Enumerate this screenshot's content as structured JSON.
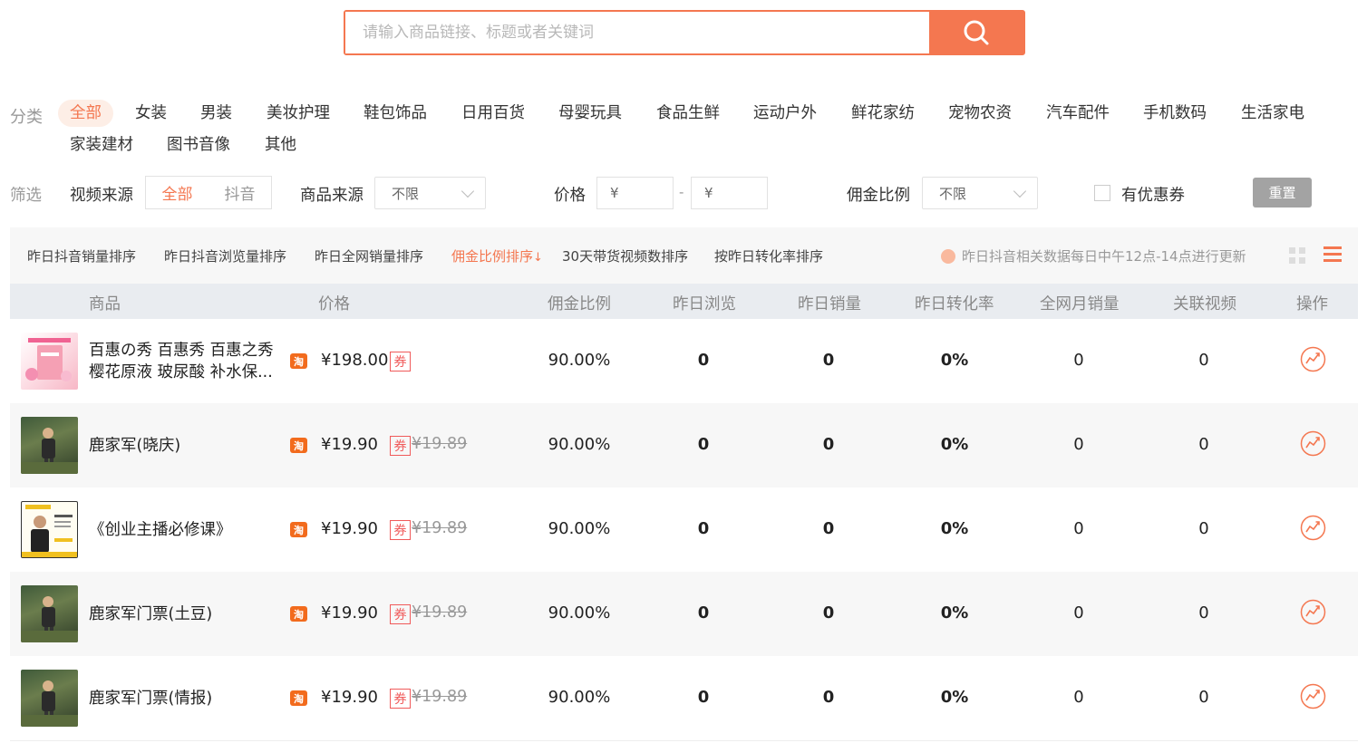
{
  "search": {
    "placeholder": "请输入商品链接、标题或者关键词",
    "button_icon": "search-icon",
    "accent": "#f47750"
  },
  "categories": {
    "label": "分类",
    "items": [
      "全部",
      "女装",
      "男装",
      "美妆护理",
      "鞋包饰品",
      "日用百货",
      "母婴玩具",
      "食品生鲜",
      "运动户外",
      "鲜花家纺",
      "宠物农资",
      "汽车配件",
      "手机数码",
      "生活家电",
      "家装建材",
      "图书音像",
      "其他"
    ],
    "active": "全部"
  },
  "filters": {
    "label": "筛选",
    "video_source_label": "视频来源",
    "video_source_options": [
      "全部",
      "抖音"
    ],
    "video_source_active": "全部",
    "product_source_label": "商品来源",
    "product_source_value": "不限",
    "price_label": "价格",
    "price_min_placeholder": "¥",
    "price_sep": "-",
    "price_max_placeholder": "¥",
    "commission_label": "佣金比例",
    "commission_value": "不限",
    "coupon_label": "有优惠券",
    "reset_label": "重置"
  },
  "sort": {
    "items": [
      "昨日抖音销量排序",
      "昨日抖音浏览量排序",
      "昨日全网销量排序",
      "佣金比例排序",
      "30天带货视频数排序",
      "按昨日转化率排序"
    ],
    "active_index": 3,
    "notice": "昨日抖音相关数据每日中午12点-14点进行更新"
  },
  "table": {
    "headers": [
      "商品",
      "价格",
      "佣金比例",
      "昨日浏览",
      "昨日销量",
      "昨日转化率",
      "全网月销量",
      "关联视频",
      "操作"
    ],
    "rows": [
      {
        "title": "百惠の秀 百惠秀 百惠之秀 樱花原液 玻尿酸 补水保...",
        "platform_badge": "淘",
        "price": "¥198.00",
        "coupon": "券",
        "old_price": "",
        "commission": "90.00%",
        "views": "0",
        "sales": "0",
        "conversion": "0%",
        "monthly_sales": "0",
        "videos": "0",
        "thumb": "pink-product"
      },
      {
        "title": "鹿家军(晓庆)",
        "platform_badge": "淘",
        "price": "¥19.90",
        "coupon": "券",
        "old_price": "¥19.89",
        "commission": "90.00%",
        "views": "0",
        "sales": "0",
        "conversion": "0%",
        "monthly_sales": "0",
        "videos": "0",
        "thumb": "outdoor-photo"
      },
      {
        "title": "《创业主播必修课》",
        "platform_badge": "淘",
        "price": "¥19.90",
        "coupon": "券",
        "old_price": "¥19.89",
        "commission": "90.00%",
        "views": "0",
        "sales": "0",
        "conversion": "0%",
        "monthly_sales": "0",
        "videos": "0",
        "thumb": "course-cover"
      },
      {
        "title": "鹿家军门票(土豆)",
        "platform_badge": "淘",
        "price": "¥19.90",
        "coupon": "券",
        "old_price": "¥19.89",
        "commission": "90.00%",
        "views": "0",
        "sales": "0",
        "conversion": "0%",
        "monthly_sales": "0",
        "videos": "0",
        "thumb": "outdoor-photo"
      },
      {
        "title": "鹿家军门票(情报)",
        "platform_badge": "淘",
        "price": "¥19.90",
        "coupon": "券",
        "old_price": "¥19.89",
        "commission": "90.00%",
        "views": "0",
        "sales": "0",
        "conversion": "0%",
        "monthly_sales": "0",
        "videos": "0",
        "thumb": "outdoor-photo"
      }
    ],
    "action_icon": "trend-chart-icon"
  }
}
